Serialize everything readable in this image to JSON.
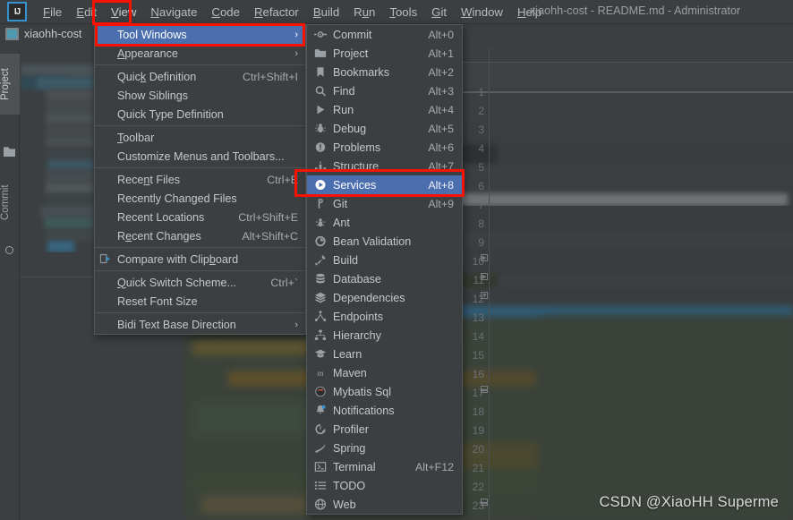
{
  "app": {
    "window_title": "xiaohh-cost - README.md - Administrator",
    "logo_text": "IJ",
    "project_name": "xiaohh-cost",
    "watermark": "CSDN @XiaoHH Superme"
  },
  "menubar": {
    "items": [
      {
        "label": "File",
        "mnemonic": "F"
      },
      {
        "label": "Edit",
        "mnemonic": "E"
      },
      {
        "label": "View",
        "mnemonic": "V",
        "active": true
      },
      {
        "label": "Navigate",
        "mnemonic": "N"
      },
      {
        "label": "Code",
        "mnemonic": "C"
      },
      {
        "label": "Refactor",
        "mnemonic": "R"
      },
      {
        "label": "Build",
        "mnemonic": "B"
      },
      {
        "label": "Run",
        "mnemonic": "u"
      },
      {
        "label": "Tools",
        "mnemonic": "T"
      },
      {
        "label": "Git",
        "mnemonic": "G"
      },
      {
        "label": "Window",
        "mnemonic": "W"
      },
      {
        "label": "Help",
        "mnemonic": "H"
      }
    ]
  },
  "left_stripe": {
    "tabs": [
      {
        "label": "Project",
        "icon": "folder-icon",
        "active": true
      },
      {
        "label": "Commit",
        "icon": "commit-icon",
        "active": false
      }
    ]
  },
  "view_menu": {
    "items": [
      {
        "label": "Tool Windows",
        "mnemonic": "",
        "shortcut": "",
        "arrow": "›",
        "selected": true,
        "icon": ""
      },
      {
        "label": "Appearance",
        "mnemonic": "A",
        "shortcut": "",
        "arrow": "›",
        "selected": false,
        "icon": ""
      },
      {
        "separator": true
      },
      {
        "label": "Quick Definition",
        "mnemonic": "k",
        "shortcut": "Ctrl+Shift+I",
        "arrow": "",
        "selected": false,
        "icon": ""
      },
      {
        "label": "Show Siblings",
        "mnemonic": "",
        "shortcut": "",
        "arrow": "",
        "selected": false,
        "icon": ""
      },
      {
        "label": "Quick Type Definition",
        "mnemonic": "",
        "shortcut": "",
        "arrow": "",
        "selected": false,
        "icon": ""
      },
      {
        "separator": true
      },
      {
        "label": "Toolbar",
        "mnemonic": "T",
        "shortcut": "",
        "arrow": "",
        "selected": false,
        "icon": ""
      },
      {
        "label": "Customize Menus and Toolbars...",
        "mnemonic": "",
        "shortcut": "",
        "arrow": "",
        "selected": false,
        "icon": ""
      },
      {
        "separator": true
      },
      {
        "label": "Recent Files",
        "mnemonic": "n",
        "shortcut": "Ctrl+E",
        "arrow": "",
        "selected": false,
        "icon": ""
      },
      {
        "label": "Recently Changed Files",
        "mnemonic": "",
        "shortcut": "",
        "arrow": "",
        "selected": false,
        "icon": ""
      },
      {
        "label": "Recent Locations",
        "mnemonic": "",
        "shortcut": "Ctrl+Shift+E",
        "arrow": "",
        "selected": false,
        "icon": ""
      },
      {
        "label": "Recent Changes",
        "mnemonic": "e",
        "shortcut": "Alt+Shift+C",
        "arrow": "",
        "selected": false,
        "icon": ""
      },
      {
        "separator": true
      },
      {
        "label": "Compare with Clipboard",
        "mnemonic": "b",
        "shortcut": "",
        "arrow": "",
        "selected": false,
        "icon": "clipboard-compare-icon"
      },
      {
        "separator": true
      },
      {
        "label": "Quick Switch Scheme...",
        "mnemonic": "Q",
        "shortcut": "Ctrl+`",
        "arrow": "",
        "selected": false,
        "icon": ""
      },
      {
        "label": "Reset Font Size",
        "mnemonic": "",
        "shortcut": "",
        "arrow": "",
        "selected": false,
        "icon": ""
      },
      {
        "separator": true
      },
      {
        "label": "Bidi Text Base Direction",
        "mnemonic": "",
        "shortcut": "",
        "arrow": "›",
        "selected": false,
        "icon": ""
      }
    ]
  },
  "tool_windows_submenu": {
    "items": [
      {
        "label": "Commit",
        "shortcut": "Alt+0",
        "icon": "commit-icon",
        "selected": false
      },
      {
        "label": "Project",
        "shortcut": "Alt+1",
        "icon": "folder-icon",
        "selected": false
      },
      {
        "label": "Bookmarks",
        "shortcut": "Alt+2",
        "icon": "bookmark-icon",
        "selected": false
      },
      {
        "label": "Find",
        "shortcut": "Alt+3",
        "icon": "search-icon",
        "selected": false
      },
      {
        "label": "Run",
        "shortcut": "Alt+4",
        "icon": "play-icon",
        "selected": false
      },
      {
        "label": "Debug",
        "shortcut": "Alt+5",
        "icon": "bug-icon",
        "selected": false
      },
      {
        "label": "Problems",
        "shortcut": "Alt+6",
        "icon": "warning-icon",
        "selected": false
      },
      {
        "label": "Structure",
        "shortcut": "Alt+7",
        "icon": "structure-icon",
        "selected": false
      },
      {
        "label": "Services",
        "shortcut": "Alt+8",
        "icon": "services-icon",
        "selected": true
      },
      {
        "label": "Git",
        "shortcut": "Alt+9",
        "icon": "git-icon",
        "selected": false
      },
      {
        "label": "Ant",
        "shortcut": "",
        "icon": "ant-icon",
        "selected": false
      },
      {
        "label": "Bean Validation",
        "shortcut": "",
        "icon": "bean-icon",
        "selected": false
      },
      {
        "label": "Build",
        "shortcut": "",
        "icon": "hammer-icon",
        "selected": false
      },
      {
        "label": "Database",
        "shortcut": "",
        "icon": "database-icon",
        "selected": false
      },
      {
        "label": "Dependencies",
        "shortcut": "",
        "icon": "layers-icon",
        "selected": false
      },
      {
        "label": "Endpoints",
        "shortcut": "",
        "icon": "endpoints-icon",
        "selected": false
      },
      {
        "label": "Hierarchy",
        "shortcut": "",
        "icon": "hierarchy-icon",
        "selected": false
      },
      {
        "label": "Learn",
        "shortcut": "",
        "icon": "graduation-icon",
        "selected": false
      },
      {
        "label": "Maven",
        "shortcut": "",
        "icon": "maven-icon",
        "selected": false
      },
      {
        "label": "Mybatis Sql",
        "shortcut": "",
        "icon": "mybatis-icon",
        "selected": false
      },
      {
        "label": "Notifications",
        "shortcut": "",
        "icon": "bell-icon",
        "selected": false
      },
      {
        "label": "Profiler",
        "shortcut": "",
        "icon": "profiler-icon",
        "selected": false
      },
      {
        "label": "Spring",
        "shortcut": "",
        "icon": "spring-leaf-icon",
        "selected": false
      },
      {
        "label": "Terminal",
        "shortcut": "Alt+F12",
        "icon": "terminal-icon",
        "selected": false
      },
      {
        "label": "TODO",
        "shortcut": "",
        "icon": "todo-list-icon",
        "selected": false
      },
      {
        "label": "Web",
        "shortcut": "",
        "icon": "globe-icon",
        "selected": false
      }
    ]
  },
  "editor": {
    "line_numbers": [
      "1",
      "2",
      "3",
      "4",
      "5",
      "6",
      "7",
      "8",
      "9",
      "10",
      "11",
      "12",
      "13",
      "14",
      "15",
      "16",
      "17",
      "18",
      "19",
      "20",
      "21",
      "22",
      "23"
    ]
  },
  "annotations": {
    "boxes": [
      {
        "target": "view-menu-item"
      },
      {
        "target": "tool-windows-item"
      },
      {
        "target": "services-item"
      }
    ],
    "color": "#fb1100"
  }
}
